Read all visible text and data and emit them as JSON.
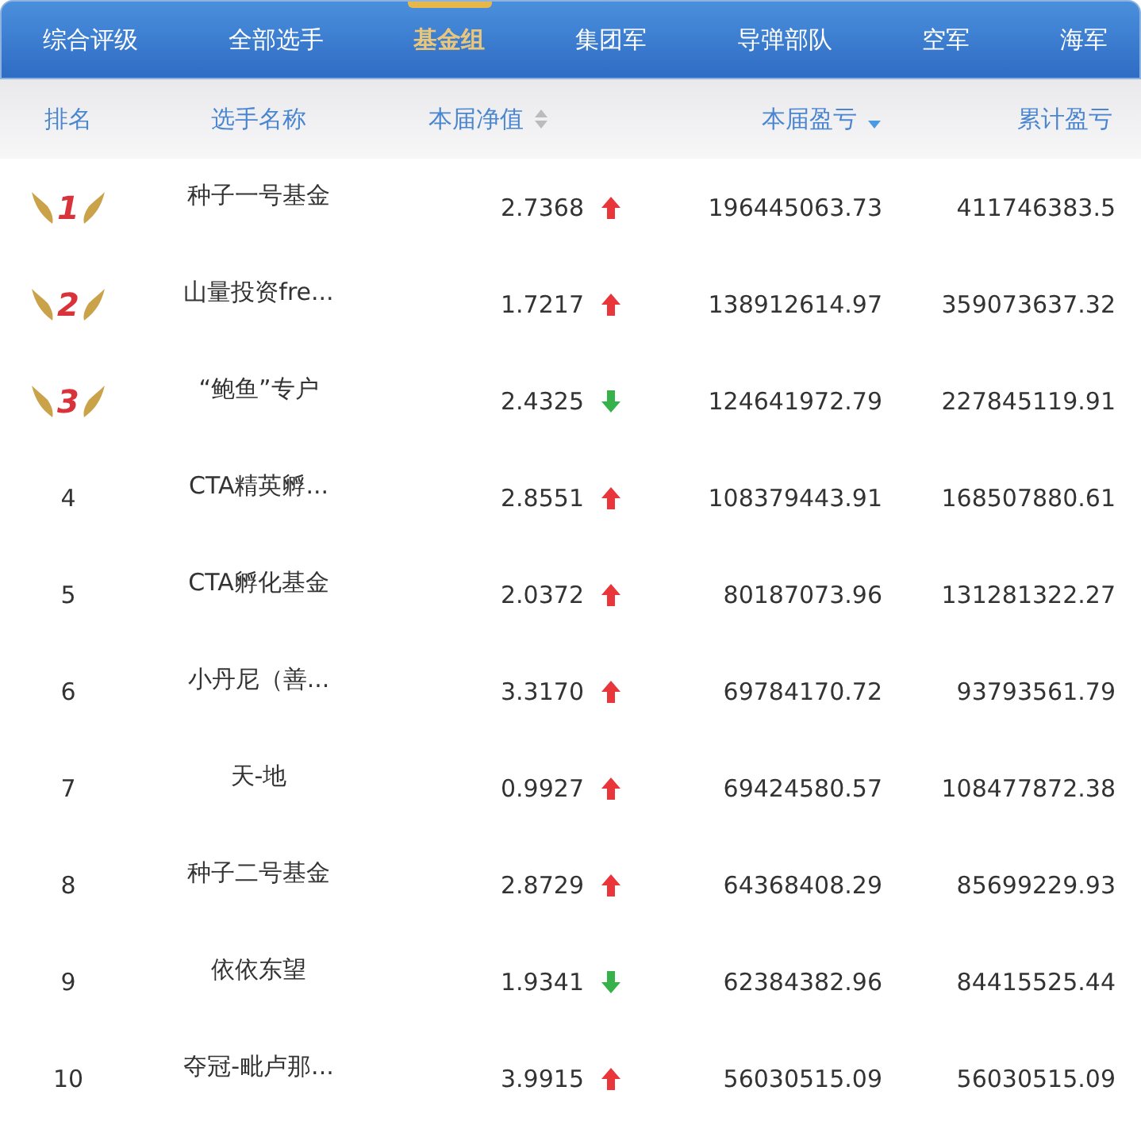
{
  "tabs": [
    {
      "label": "综合评级",
      "selected": false
    },
    {
      "label": "全部选手",
      "selected": false
    },
    {
      "label": "基金组",
      "selected": true
    },
    {
      "label": "集团军",
      "selected": false
    },
    {
      "label": "导弹部队",
      "selected": false
    },
    {
      "label": "空军",
      "selected": false
    },
    {
      "label": "海军",
      "selected": false
    }
  ],
  "table": {
    "columns": [
      {
        "label": "排名",
        "kind": "plain"
      },
      {
        "label": "选手名称",
        "kind": "plain"
      },
      {
        "label": "本届净值",
        "kind": "sortable",
        "sorted": false
      },
      {
        "label": "本届盈亏",
        "kind": "sortable",
        "sorted": true
      },
      {
        "label": "累计盈亏",
        "kind": "plain"
      }
    ],
    "rows": [
      {
        "rank": "1",
        "kind": "medal",
        "name": "种子一号基金",
        "nav": "2.7368",
        "rising": true,
        "profit": "196445063.73",
        "total": "411746383.5"
      },
      {
        "rank": "2",
        "kind": "medal",
        "name": "山量投资fre...",
        "nav": "1.7217",
        "rising": true,
        "profit": "138912614.97",
        "total": "359073637.32"
      },
      {
        "rank": "3",
        "kind": "medal",
        "name": "“鲍鱼”专户",
        "nav": "2.4325",
        "rising": false,
        "profit": "124641972.79",
        "total": "227845119.91"
      },
      {
        "rank": "4",
        "kind": "plain",
        "name": "CTA精英孵...",
        "nav": "2.8551",
        "rising": true,
        "profit": "108379443.91",
        "total": "168507880.61"
      },
      {
        "rank": "5",
        "kind": "plain",
        "name": "CTA孵化基金",
        "nav": "2.0372",
        "rising": true,
        "profit": "80187073.96",
        "total": "131281322.27"
      },
      {
        "rank": "6",
        "kind": "plain",
        "name": "小丹尼（善...",
        "nav": "3.3170",
        "rising": true,
        "profit": "69784170.72",
        "total": "93793561.79"
      },
      {
        "rank": "7",
        "kind": "plain",
        "name": "天-地",
        "nav": "0.9927",
        "rising": true,
        "profit": "69424580.57",
        "total": "108477872.38"
      },
      {
        "rank": "8",
        "kind": "plain",
        "name": "种子二号基金",
        "nav": "2.8729",
        "rising": true,
        "profit": "64368408.29",
        "total": "85699229.93"
      },
      {
        "rank": "9",
        "kind": "plain",
        "name": "依依东望",
        "nav": "1.9341",
        "rising": false,
        "profit": "62384382.96",
        "total": "84415525.44"
      },
      {
        "rank": "10",
        "kind": "plain",
        "name": "夺冠-毗卢那...",
        "nav": "3.9915",
        "rising": true,
        "profit": "56030515.09",
        "total": "56030515.09"
      }
    ]
  }
}
